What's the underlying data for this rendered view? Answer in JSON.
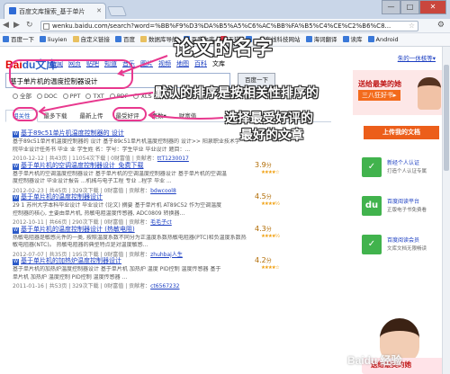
{
  "browser": {
    "tab_title": "百度文库搜索_基于单片",
    "url": "wenku.baidu.com/search?word=%BB%F9%D3%DA%B5%A5%C6%AC%BB%FA%B5%C4%CE%C2%B6%C8...",
    "window_controls": [
      "—",
      "□",
      "✕"
    ]
  },
  "bookmarks": [
    {
      "label": "百度一下",
      "icon": "ic"
    },
    {
      "label": "liuyien",
      "icon": "ic"
    },
    {
      "label": "自定义链接",
      "icon": "fold"
    },
    {
      "label": "百度",
      "icon": "ic"
    },
    {
      "label": "数据库导航",
      "icon": "fold"
    },
    {
      "label": "百度文库",
      "icon": "ic"
    },
    {
      "label": "天猫",
      "icon": "red"
    },
    {
      "label": "一个在线科技网站",
      "icon": "ic"
    },
    {
      "label": "海词翻译",
      "icon": "ic"
    },
    {
      "label": "读库",
      "icon": "ic"
    },
    {
      "label": "Android",
      "icon": "ic"
    }
  ],
  "site": {
    "logo_a": "Bai",
    "logo_b": "du文库",
    "nav": [
      "新闻",
      "网页",
      "贴吧",
      "知道",
      "音乐",
      "图片",
      "视频",
      "地图",
      "百科",
      "文库"
    ],
    "nav_current": "文库",
    "user_link": "朱的一休核等▾",
    "search_value": "基于单片机的温度控制器设计",
    "search_button": "百度一下",
    "filters": [
      "全部",
      "DOC",
      "PPT",
      "TXT",
      "PDF",
      "XLS"
    ],
    "banner_title": "送给最美的她",
    "banner_sub": "三八狂好书▸"
  },
  "sort_tabs": [
    "相关性",
    "最多下载",
    "最新上传",
    "最受好评",
    "页数▾",
    "财富值"
  ],
  "results": [
    {
      "title": "基于89c51单片机温度控制器的 设计",
      "ext": "",
      "abstract": "基于89c51单片机温度控制器的 设计 基于89c51单片机温度控制器的 设计>> 阳泉职业技术学",
      "abstract2": "院毕业设计任务书 毕业 业 学生姓 名：学号：学生毕业 毕业设计 题目：...",
      "meta": "2010-12-12 | 共43页 | 11054次下载 | 0财富值 | 贡献者：",
      "uploader": "ttT1230017",
      "score": "",
      "stars": ""
    },
    {
      "title": "基于单片机的空调温度控制器设计_免费下载",
      "ext": "",
      "abstract": "基于单片机的空调温度控制器设计 基于单片机的空调温度控制器设计 基于单片机的空调温",
      "abstract2": "度控制器设计 毕业设计报告 ...机械与电子工程 专业 ..程学 毕业 ...",
      "meta": "2012-02-23 | 共45页 | 329次下载 | 0财富值 | 贡献者：",
      "uploader": "bdwcool8",
      "score": "3.9",
      "stars": "★★★★☆"
    },
    {
      "title": "基于单片机的温度控制器设计",
      "ext": "",
      "abstract": "29 1 苏州大学本科毕业设计 毕业设计 (论文) 摘要 基于单片机 AT89C52 作为空调温度",
      "abstract2": "控制器的核心, 主要由单片机, 热敏电阻温度传感器, ADC0809 转换器...",
      "meta": "2012-10-11 | 共66页 | 290次下载 | 0财富值 | 贡献者：",
      "uploader": "毛毛子ct",
      "score": "4.5",
      "stars": "★★★★½"
    },
    {
      "title": "基于单片机的温度控制器设计 (热敏电阻)",
      "ext": "",
      "abstract": "热敏电阻器是敏感元件的一类, 按照温度系数不同分为正温度系数热敏电阻器(PTC)和负温度系数热",
      "abstract2": "敏电阻器(NTC)。 热敏电阻器的典型特点是对温度敏感...",
      "meta": "2012-07-07 | 共35页 | 195次下载 | 0财富值 | 贡献者：",
      "uploader": "zhuhbaj人生",
      "score": "4.3",
      "stars": "★★★★½"
    },
    {
      "title": "基于单片机的加热炉温度控制器设计",
      "ext": "",
      "abstract": "基于单片机的加热炉温度控制器设计 基于单片机 加热炉 温度 PID控制 温度传感器 基于",
      "abstract2": "单片机 加热炉 温度控制 PID控制 温度传感器 ...",
      "meta": "2011-01-16 | 共53页 | 329次下载 | 0财富值 | 贡献者：",
      "uploader": "ct6567232",
      "score": "4.2",
      "stars": "★★★★☆"
    }
  ],
  "right_col": {
    "upload_button": "上传我的文档",
    "certs": [
      {
        "icon": "✓",
        "title": "新经个人认证",
        "desc": "打造个人认证专属"
      },
      {
        "icon": "du",
        "title": "百度阅读平台",
        "desc": "正版电子书免费看"
      },
      {
        "icon": "✓",
        "title": "百度阅读会员",
        "desc": "文库文档无限畅读"
      }
    ],
    "promo": "送给最美的她"
  },
  "annotations": {
    "title": "论文的名字",
    "sort_note": "默认的排序是按相关性排序的",
    "best_note_1": "选择最受好评的",
    "best_note_2": "最好的文章"
  },
  "watermark": "Baidu 经验"
}
